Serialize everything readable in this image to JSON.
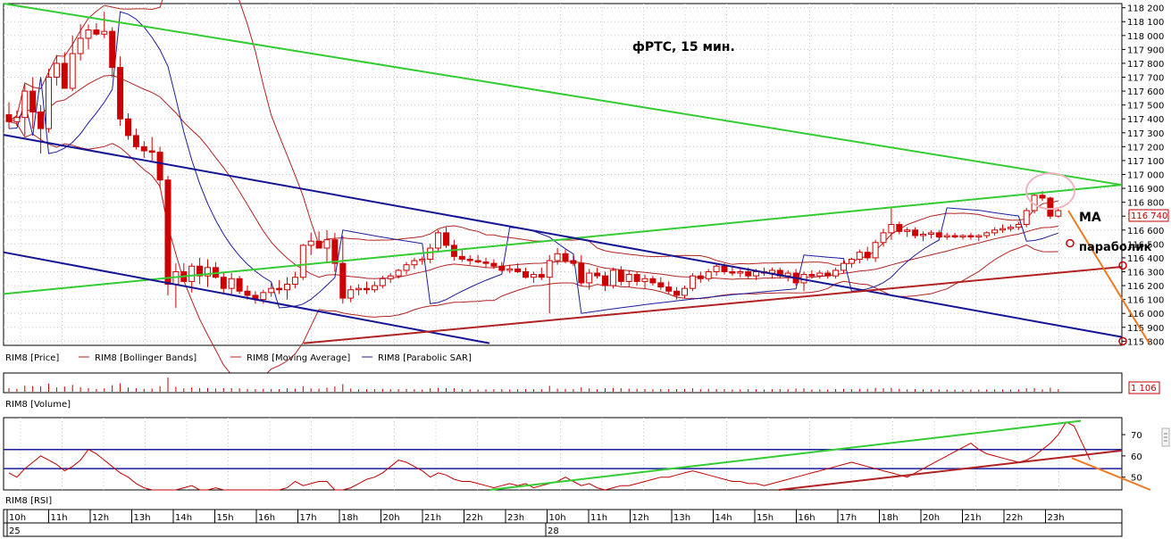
{
  "chart_data": [
    {
      "type": "candlestick",
      "title": "фРТС, 15 мин.",
      "legend": [
        {
          "name": "RIM8 [Price]",
          "color": "#c00000"
        },
        {
          "name": "RIM8 [Bollinger Bands]",
          "color": "#b22222"
        },
        {
          "name": "RIM8 [Moving Average]",
          "color": "#b22222"
        },
        {
          "name": "RIM8 [Parabolic SAR]",
          "color": "#1c1c9c"
        }
      ],
      "ylim": [
        115770,
        118230
      ],
      "y_ticks": [
        118200,
        118100,
        118000,
        117900,
        117800,
        117700,
        117600,
        117500,
        117400,
        117300,
        117200,
        117100,
        117000,
        116900,
        116800,
        116700,
        116600,
        116500,
        116400,
        116300,
        116200,
        116100,
        116000,
        115900,
        115800
      ],
      "last_price": "116 740",
      "annotations": [
        "MA",
        "параболик"
      ],
      "candles": [
        {
          "o": 117430,
          "h": 117520,
          "l": 117330,
          "c": 117380
        },
        {
          "o": 117380,
          "h": 117460,
          "l": 117350,
          "c": 117410
        },
        {
          "o": 117410,
          "h": 117650,
          "l": 117280,
          "c": 117600
        },
        {
          "o": 117600,
          "h": 117700,
          "l": 117330,
          "c": 117450
        },
        {
          "o": 117450,
          "h": 117500,
          "l": 117150,
          "c": 117330
        },
        {
          "o": 117330,
          "h": 117760,
          "l": 117300,
          "c": 117700
        },
        {
          "o": 117700,
          "h": 117860,
          "l": 117640,
          "c": 117800
        },
        {
          "o": 117800,
          "h": 117880,
          "l": 117620,
          "c": 117620
        },
        {
          "o": 117620,
          "h": 118000,
          "l": 117600,
          "c": 117870
        },
        {
          "o": 117870,
          "h": 118080,
          "l": 117820,
          "c": 117980
        },
        {
          "o": 117980,
          "h": 118080,
          "l": 117900,
          "c": 118040
        },
        {
          "o": 118040,
          "h": 118090,
          "l": 118000,
          "c": 118010
        },
        {
          "o": 118010,
          "h": 118170,
          "l": 117980,
          "c": 118030
        },
        {
          "o": 118030,
          "h": 118060,
          "l": 117700,
          "c": 117770
        },
        {
          "o": 117770,
          "h": 117850,
          "l": 117350,
          "c": 117400
        },
        {
          "o": 117400,
          "h": 117440,
          "l": 117250,
          "c": 117280
        },
        {
          "o": 117280,
          "h": 117330,
          "l": 117180,
          "c": 117200
        },
        {
          "o": 117200,
          "h": 117240,
          "l": 117120,
          "c": 117170
        },
        {
          "o": 117170,
          "h": 117270,
          "l": 117100,
          "c": 117160
        },
        {
          "o": 117160,
          "h": 117200,
          "l": 116900,
          "c": 116960
        },
        {
          "o": 116960,
          "h": 116990,
          "l": 116130,
          "c": 116210
        },
        {
          "o": 116210,
          "h": 116360,
          "l": 116040,
          "c": 116300
        },
        {
          "o": 116300,
          "h": 116360,
          "l": 116240,
          "c": 116230
        },
        {
          "o": 116230,
          "h": 116360,
          "l": 116150,
          "c": 116340
        },
        {
          "o": 116340,
          "h": 116400,
          "l": 116210,
          "c": 116270
        },
        {
          "o": 116270,
          "h": 116390,
          "l": 116190,
          "c": 116330
        },
        {
          "o": 116330,
          "h": 116370,
          "l": 116250,
          "c": 116260
        },
        {
          "o": 116260,
          "h": 116300,
          "l": 116140,
          "c": 116180
        },
        {
          "o": 116180,
          "h": 116290,
          "l": 116130,
          "c": 116250
        },
        {
          "o": 116250,
          "h": 116270,
          "l": 116140,
          "c": 116160
        },
        {
          "o": 116160,
          "h": 116200,
          "l": 116100,
          "c": 116130
        },
        {
          "o": 116130,
          "h": 116160,
          "l": 116070,
          "c": 116100
        },
        {
          "o": 116100,
          "h": 116170,
          "l": 116070,
          "c": 116150
        },
        {
          "o": 116150,
          "h": 116220,
          "l": 116120,
          "c": 116180
        },
        {
          "o": 116180,
          "h": 116240,
          "l": 116140,
          "c": 116170
        },
        {
          "o": 116170,
          "h": 116260,
          "l": 116100,
          "c": 116210
        },
        {
          "o": 116210,
          "h": 116300,
          "l": 116180,
          "c": 116260
        },
        {
          "o": 116260,
          "h": 116500,
          "l": 116240,
          "c": 116490
        },
        {
          "o": 116490,
          "h": 116580,
          "l": 116420,
          "c": 116520
        },
        {
          "o": 116520,
          "h": 116590,
          "l": 116470,
          "c": 116470
        },
        {
          "o": 116470,
          "h": 116600,
          "l": 116360,
          "c": 116530
        },
        {
          "o": 116530,
          "h": 116580,
          "l": 116300,
          "c": 116360
        },
        {
          "o": 116360,
          "h": 116560,
          "l": 116070,
          "c": 116110
        },
        {
          "o": 116110,
          "h": 116200,
          "l": 116080,
          "c": 116170
        },
        {
          "o": 116170,
          "h": 116210,
          "l": 116130,
          "c": 116180
        },
        {
          "o": 116180,
          "h": 116230,
          "l": 116140,
          "c": 116170
        },
        {
          "o": 116170,
          "h": 116230,
          "l": 116150,
          "c": 116200
        },
        {
          "o": 116200,
          "h": 116270,
          "l": 116180,
          "c": 116250
        },
        {
          "o": 116250,
          "h": 116290,
          "l": 116220,
          "c": 116270
        },
        {
          "o": 116270,
          "h": 116320,
          "l": 116250,
          "c": 116310
        },
        {
          "o": 116310,
          "h": 116370,
          "l": 116280,
          "c": 116350
        },
        {
          "o": 116350,
          "h": 116400,
          "l": 116320,
          "c": 116380
        },
        {
          "o": 116380,
          "h": 116410,
          "l": 116350,
          "c": 116390
        },
        {
          "o": 116390,
          "h": 116500,
          "l": 116360,
          "c": 116470
        },
        {
          "o": 116470,
          "h": 116600,
          "l": 116440,
          "c": 116580
        },
        {
          "o": 116580,
          "h": 116620,
          "l": 116470,
          "c": 116490
        },
        {
          "o": 116490,
          "h": 116530,
          "l": 116380,
          "c": 116410
        },
        {
          "o": 116410,
          "h": 116460,
          "l": 116370,
          "c": 116390
        },
        {
          "o": 116390,
          "h": 116420,
          "l": 116350,
          "c": 116380
        },
        {
          "o": 116380,
          "h": 116420,
          "l": 116360,
          "c": 116370
        },
        {
          "o": 116370,
          "h": 116400,
          "l": 116330,
          "c": 116360
        },
        {
          "o": 116360,
          "h": 116390,
          "l": 116320,
          "c": 116340
        },
        {
          "o": 116340,
          "h": 116370,
          "l": 116300,
          "c": 116310
        },
        {
          "o": 116310,
          "h": 116350,
          "l": 116290,
          "c": 116320
        },
        {
          "o": 116320,
          "h": 116360,
          "l": 116290,
          "c": 116300
        },
        {
          "o": 116300,
          "h": 116330,
          "l": 116250,
          "c": 116260
        },
        {
          "o": 116260,
          "h": 116300,
          "l": 116220,
          "c": 116280
        },
        {
          "o": 116280,
          "h": 116330,
          "l": 116240,
          "c": 116260
        },
        {
          "o": 116260,
          "h": 116420,
          "l": 116000,
          "c": 116380
        },
        {
          "o": 116380,
          "h": 116470,
          "l": 116350,
          "c": 116430
        },
        {
          "o": 116430,
          "h": 116460,
          "l": 116360,
          "c": 116380
        },
        {
          "o": 116380,
          "h": 116420,
          "l": 116340,
          "c": 116360
        },
        {
          "o": 116360,
          "h": 116420,
          "l": 116200,
          "c": 116220
        },
        {
          "o": 116220,
          "h": 116320,
          "l": 116170,
          "c": 116290
        },
        {
          "o": 116290,
          "h": 116330,
          "l": 116250,
          "c": 116270
        },
        {
          "o": 116270,
          "h": 116300,
          "l": 116160,
          "c": 116200
        },
        {
          "o": 116200,
          "h": 116330,
          "l": 116180,
          "c": 116310
        },
        {
          "o": 116310,
          "h": 116340,
          "l": 116200,
          "c": 116230
        },
        {
          "o": 116230,
          "h": 116310,
          "l": 116190,
          "c": 116280
        },
        {
          "o": 116280,
          "h": 116300,
          "l": 116200,
          "c": 116230
        },
        {
          "o": 116230,
          "h": 116280,
          "l": 116180,
          "c": 116250
        },
        {
          "o": 116250,
          "h": 116270,
          "l": 116200,
          "c": 116220
        },
        {
          "o": 116220,
          "h": 116260,
          "l": 116170,
          "c": 116190
        },
        {
          "o": 116190,
          "h": 116230,
          "l": 116140,
          "c": 116160
        },
        {
          "o": 116160,
          "h": 116190,
          "l": 116100,
          "c": 116130
        },
        {
          "o": 116130,
          "h": 116200,
          "l": 116110,
          "c": 116180
        },
        {
          "o": 116180,
          "h": 116290,
          "l": 116160,
          "c": 116270
        },
        {
          "o": 116270,
          "h": 116300,
          "l": 116220,
          "c": 116250
        },
        {
          "o": 116250,
          "h": 116320,
          "l": 116230,
          "c": 116300
        },
        {
          "o": 116300,
          "h": 116360,
          "l": 116270,
          "c": 116340
        },
        {
          "o": 116340,
          "h": 116360,
          "l": 116280,
          "c": 116300
        },
        {
          "o": 116300,
          "h": 116330,
          "l": 116270,
          "c": 116290
        },
        {
          "o": 116290,
          "h": 116320,
          "l": 116260,
          "c": 116300
        },
        {
          "o": 116300,
          "h": 116330,
          "l": 116250,
          "c": 116270
        },
        {
          "o": 116270,
          "h": 116320,
          "l": 116240,
          "c": 116300
        },
        {
          "o": 116300,
          "h": 116330,
          "l": 116270,
          "c": 116290
        },
        {
          "o": 116290,
          "h": 116330,
          "l": 116250,
          "c": 116310
        },
        {
          "o": 116310,
          "h": 116330,
          "l": 116250,
          "c": 116270
        },
        {
          "o": 116270,
          "h": 116310,
          "l": 116230,
          "c": 116290
        },
        {
          "o": 116290,
          "h": 116320,
          "l": 116200,
          "c": 116220
        },
        {
          "o": 116220,
          "h": 116300,
          "l": 116160,
          "c": 116280
        },
        {
          "o": 116280,
          "h": 116310,
          "l": 116250,
          "c": 116270
        },
        {
          "o": 116270,
          "h": 116310,
          "l": 116250,
          "c": 116290
        },
        {
          "o": 116290,
          "h": 116310,
          "l": 116250,
          "c": 116270
        },
        {
          "o": 116270,
          "h": 116330,
          "l": 116250,
          "c": 116310
        },
        {
          "o": 116310,
          "h": 116380,
          "l": 116290,
          "c": 116360
        },
        {
          "o": 116360,
          "h": 116400,
          "l": 116330,
          "c": 116390
        },
        {
          "o": 116390,
          "h": 116460,
          "l": 116360,
          "c": 116440
        },
        {
          "o": 116440,
          "h": 116480,
          "l": 116380,
          "c": 116400
        },
        {
          "o": 116400,
          "h": 116530,
          "l": 116370,
          "c": 116510
        },
        {
          "o": 116510,
          "h": 116610,
          "l": 116480,
          "c": 116580
        },
        {
          "o": 116580,
          "h": 116760,
          "l": 116530,
          "c": 116640
        },
        {
          "o": 116640,
          "h": 116660,
          "l": 116570,
          "c": 116590
        },
        {
          "o": 116590,
          "h": 116620,
          "l": 116550,
          "c": 116600
        },
        {
          "o": 116600,
          "h": 116620,
          "l": 116540,
          "c": 116560
        },
        {
          "o": 116560,
          "h": 116590,
          "l": 116520,
          "c": 116570
        },
        {
          "o": 116570,
          "h": 116600,
          "l": 116540,
          "c": 116580
        },
        {
          "o": 116580,
          "h": 116600,
          "l": 116540,
          "c": 116550
        },
        {
          "o": 116550,
          "h": 116580,
          "l": 116530,
          "c": 116560
        },
        {
          "o": 116560,
          "h": 116580,
          "l": 116540,
          "c": 116550
        },
        {
          "o": 116550,
          "h": 116570,
          "l": 116530,
          "c": 116560
        },
        {
          "o": 116560,
          "h": 116580,
          "l": 116530,
          "c": 116550
        },
        {
          "o": 116550,
          "h": 116570,
          "l": 116520,
          "c": 116560
        },
        {
          "o": 116560,
          "h": 116590,
          "l": 116540,
          "c": 116580
        },
        {
          "o": 116580,
          "h": 116620,
          "l": 116560,
          "c": 116600
        },
        {
          "o": 116600,
          "h": 116640,
          "l": 116580,
          "c": 116610
        },
        {
          "o": 116610,
          "h": 116640,
          "l": 116590,
          "c": 116620
        },
        {
          "o": 116620,
          "h": 116660,
          "l": 116600,
          "c": 116640
        },
        {
          "o": 116640,
          "h": 116760,
          "l": 116620,
          "c": 116740
        },
        {
          "o": 116740,
          "h": 116860,
          "l": 116720,
          "c": 116850
        },
        {
          "o": 116850,
          "h": 116880,
          "l": 116810,
          "c": 116830
        },
        {
          "o": 116830,
          "h": 116840,
          "l": 116680,
          "c": 116700
        },
        {
          "o": 116700,
          "h": 116760,
          "l": 116690,
          "c": 116740
        }
      ]
    },
    {
      "type": "bar",
      "legend": [
        {
          "name": "RIM8 [Volume]",
          "color": "#c00000"
        }
      ],
      "last_value": "1 106"
    },
    {
      "type": "line",
      "legend": [
        {
          "name": "RIM8 [RSI]",
          "color": "#c00000"
        }
      ],
      "ylim": [
        44,
        78
      ],
      "y_ticks": [
        70,
        60,
        50
      ],
      "levels": [
        63,
        54
      ],
      "values": [
        52,
        50,
        54,
        57,
        60,
        58,
        56,
        53,
        55,
        58,
        63,
        61,
        58,
        55,
        52,
        50,
        47,
        45,
        44,
        44,
        44,
        44,
        45,
        46,
        44,
        44,
        45,
        44,
        44,
        44,
        44,
        44,
        44,
        44,
        44,
        45,
        48,
        46,
        47,
        48,
        48,
        44,
        44,
        45,
        47,
        49,
        50,
        52,
        55,
        58,
        57,
        55,
        53,
        50,
        52,
        51,
        49,
        48,
        48,
        47,
        46,
        45,
        46,
        47,
        46,
        47,
        45,
        46,
        47,
        48,
        50,
        48,
        46,
        47,
        45,
        44,
        45,
        46,
        46,
        47,
        48,
        49,
        50,
        50,
        51,
        52,
        53,
        52,
        51,
        50,
        49,
        48,
        48,
        47,
        47,
        46,
        47,
        48,
        49,
        50,
        51,
        52,
        53,
        54,
        55,
        56,
        57,
        56,
        55,
        54,
        53,
        52,
        51,
        50,
        52,
        54,
        56,
        58,
        60,
        62,
        64,
        66,
        63,
        61,
        60,
        59,
        58,
        57,
        58,
        60,
        63,
        66,
        70,
        76,
        74,
        66,
        58
      ]
    },
    {
      "type": "time_axis",
      "hours": [
        "10h",
        "11h",
        "12h",
        "13h",
        "14h",
        "15h",
        "16h",
        "17h",
        "18h",
        "20h",
        "21h",
        "22h",
        "23h",
        "10h",
        "11h",
        "12h",
        "13h",
        "14h",
        "15h",
        "16h",
        "17h",
        "18h",
        "20h",
        "21h",
        "22h",
        "23h"
      ],
      "dates": [
        "25",
        "28"
      ]
    }
  ]
}
